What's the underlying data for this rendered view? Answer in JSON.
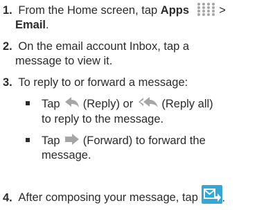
{
  "steps": [
    {
      "number": "1.",
      "pre": "From the Home screen, tap ",
      "bold1": "Apps",
      "icon1": "apps-grid-icon",
      "sep": " >",
      "bold2": "Email",
      "post": "."
    },
    {
      "number": "2.",
      "line1": "On the email account Inbox, tap a",
      "line2": "message to view it."
    },
    {
      "number": "3.",
      "text": "To reply to or forward a message:"
    },
    {
      "number": "4.",
      "pre": "After composing your message, tap ",
      "icon": "send-icon",
      "post": "."
    }
  ],
  "bullets": [
    {
      "pre": "Tap ",
      "icon_a": "reply-icon",
      "mid": " (Reply) or ",
      "icon_b": "reply-all-icon",
      "post": " (Reply all)",
      "line2": "to reply to the message."
    },
    {
      "pre": "Tap ",
      "icon": "forward-icon",
      "post": " (Forward) to forward the",
      "line2": "message."
    }
  ],
  "colors": {
    "text": "#2b2b2b",
    "icon_gray": "#a6a6a6",
    "send_blue": "#33a8d8"
  }
}
